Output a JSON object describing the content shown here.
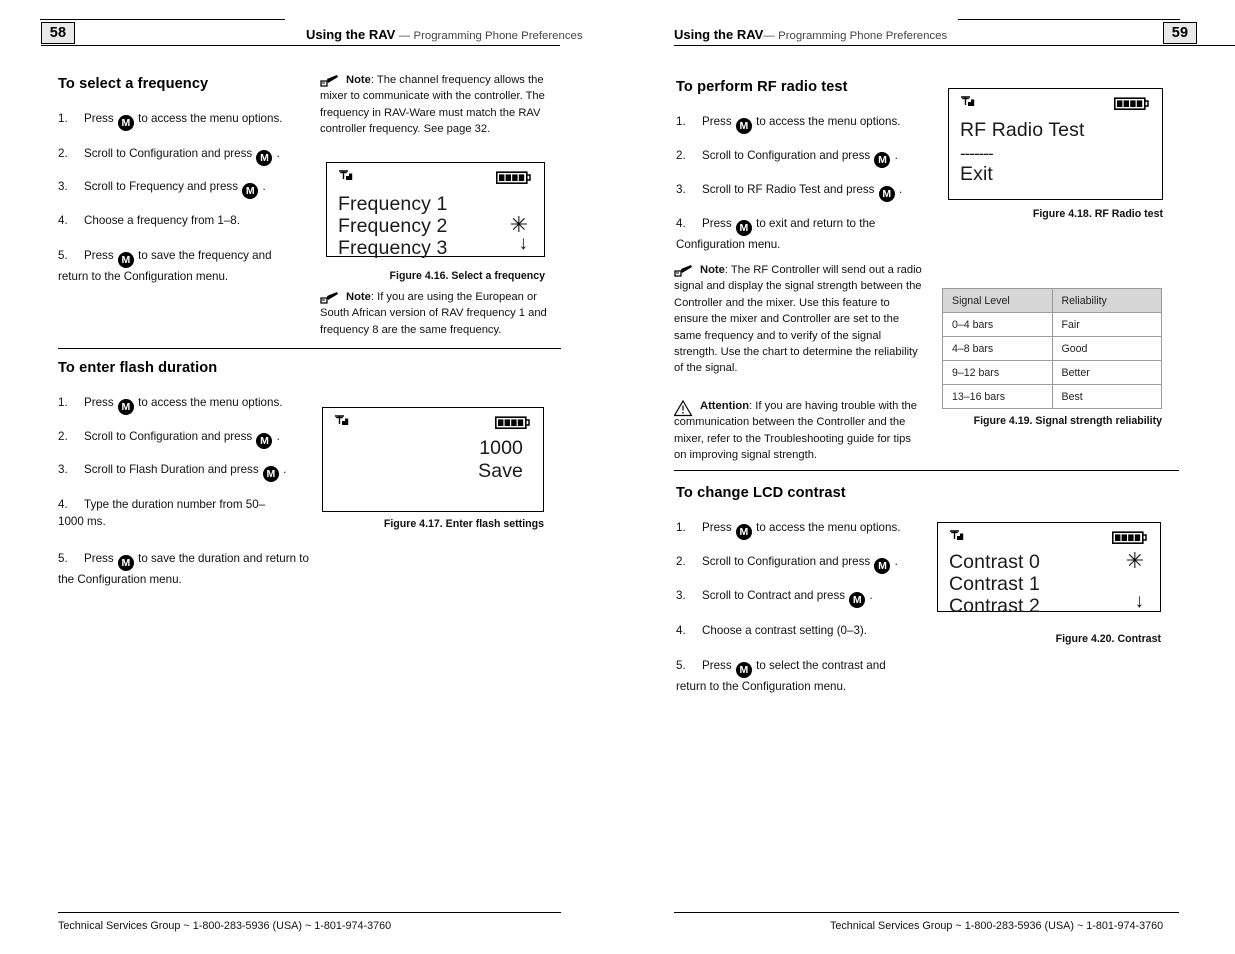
{
  "left_page": {
    "number": "58",
    "header": {
      "title": "Using the RAV",
      "dash": "—",
      "subtitle": "Programming Phone Preferences"
    },
    "footer": "Technical Services Group ~ 1-800-283-5936 (USA) ~ 1-801-974-3760",
    "sections": [
      {
        "heading": "To select a frequency",
        "steps": [
          {
            "num": "1.",
            "pre": "Press",
            "key": "M",
            "post": "to access the menu options."
          },
          {
            "num": "2.",
            "pre": "Scroll to Configuration and press",
            "key": "M",
            "post": "."
          },
          {
            "num": "3.",
            "pre": "Scroll to Frequency and press",
            "key": "M",
            "post": "."
          },
          {
            "num": "4.",
            "pre": "Choose a frequency from 1–8.",
            "key": "",
            "post": ""
          },
          {
            "num": "5.",
            "pre": "Press",
            "key": "M",
            "post": "to save the frequency and return to the Configuration menu."
          }
        ]
      },
      {
        "heading": "To enter flash duration",
        "steps": [
          {
            "num": "1.",
            "pre": "Press",
            "key": "M",
            "post": "to access the menu options."
          },
          {
            "num": "2.",
            "pre": "Scroll to Configuration and press",
            "key": "M",
            "post": "."
          },
          {
            "num": "3.",
            "pre": "Scroll to Flash Duration and press",
            "key": "M",
            "post": "."
          },
          {
            "num": "4.",
            "pre": "Type the duration number from 50–1000 ms.",
            "key": "",
            "post": ""
          },
          {
            "num": "5.",
            "pre": "Press",
            "key": "M",
            "post": "to save the duration and return to the Configuration menu."
          }
        ]
      }
    ],
    "note_frequency": {
      "label": "Note",
      "text": ": The channel frequency allows the mixer to communicate with the controller. The frequency in RAV-Ware must match the RAV controller frequency. See page 32."
    },
    "note_european": {
      "label": "Note",
      "text": ": If you are using the European or South African version of RAV frequency 1 and frequency 8 are the same frequency."
    },
    "figure_416": {
      "caption": "Figure 4.16. Select a frequency",
      "lines": [
        "Frequency 1",
        "Frequency 2",
        "Frequency 3"
      ],
      "marks": [
        "",
        "✳",
        "↓"
      ]
    },
    "figure_417": {
      "caption": "Figure 4.17. Enter flash settings",
      "lines": [
        "1000",
        "Save"
      ]
    }
  },
  "right_page": {
    "number": "59",
    "header": {
      "title": "Using the RAV",
      "dash": "—",
      "subtitle": "Programming Phone Preferences"
    },
    "footer": "Technical Services Group ~ 1-800-283-5936 (USA) ~ 1-801-974-3760",
    "sections": [
      {
        "heading": "To perform RF radio test",
        "steps": [
          {
            "num": "1.",
            "pre": "Press",
            "key": "M",
            "post": "to access the menu options."
          },
          {
            "num": "2.",
            "pre": "Scroll to Configuration and press",
            "key": "M",
            "post": "."
          },
          {
            "num": "3.",
            "pre": "Scroll to RF Radio Test and press",
            "key": "M",
            "post": "."
          },
          {
            "num": "4.",
            "pre": "Press",
            "key": "M",
            "post": "to exit and return to the Configuration menu."
          }
        ]
      },
      {
        "heading": "To change LCD contrast",
        "steps": [
          {
            "num": "1.",
            "pre": "Press",
            "key": "M",
            "post": "to access the menu options."
          },
          {
            "num": "2.",
            "pre": "Scroll to Configuration and press",
            "key": "M",
            "post": "."
          },
          {
            "num": "3.",
            "pre": "Scroll to Contract and press",
            "key": "M",
            "post": "."
          },
          {
            "num": "4.",
            "pre": "Choose a contrast setting (0–3).",
            "key": "",
            "post": ""
          },
          {
            "num": "5.",
            "pre": "Press",
            "key": "M",
            "post": "to select the contrast and return to the Configuration menu."
          }
        ]
      }
    ],
    "note_rf": {
      "label": "Note",
      "text": ": The RF Controller will send out a radio signal and display the signal strength between the Controller and the mixer. Use this feature to ensure the mixer and Controller are set to the same frequency and to verify of the signal strength. Use the chart to determine the reliability of the signal."
    },
    "attention": {
      "label": "Attention",
      "text": ": If you are having trouble with the communication between the Controller and the mixer, refer to the Troubleshooting guide for tips on improving signal strength."
    },
    "figure_418": {
      "caption": "Figure 4.18. RF Radio test",
      "lines": [
        "RF Radio Test",
        "-------",
        "Exit"
      ]
    },
    "figure_419": {
      "caption": "Figure 4.19. Signal strength reliability",
      "columns": [
        "Signal Level",
        "Reliability"
      ],
      "rows": [
        [
          "0–4 bars",
          "Fair"
        ],
        [
          "4–8 bars",
          "Good"
        ],
        [
          "9–12 bars",
          "Better"
        ],
        [
          "13–16 bars",
          "Best"
        ]
      ]
    },
    "figure_420": {
      "caption": "Figure 4.20. Contrast",
      "lines": [
        "Contrast 0",
        "Contrast 1",
        "Contrast 2"
      ],
      "marks": [
        "✳",
        "",
        "↓"
      ]
    }
  },
  "colors": {
    "page_number_bg": "#e9e9e9",
    "table_header_bg": "#d6d6d6",
    "rule": "#000000"
  }
}
